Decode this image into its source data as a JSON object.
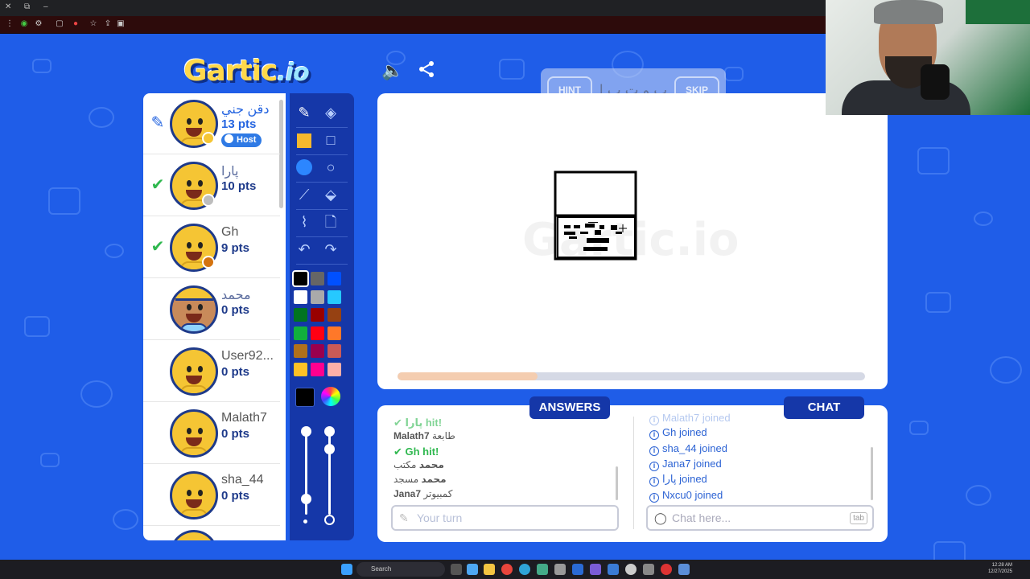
{
  "browser": {
    "toolbar_icons": [
      "shield-icon",
      "extension-icon",
      "tabs-icon",
      "record-icon",
      "star-icon",
      "share-icon",
      "profile-icon"
    ]
  },
  "header": {
    "logo_text": "Gartic",
    "logo_suffix": ".io",
    "sound_icon": "speaker-icon",
    "share_icon": "share-icon"
  },
  "word_hint": {
    "hint_label": "HINT",
    "word": "ب و ت ب ا ل",
    "skip_label": "SKIP"
  },
  "players": [
    {
      "name": "دقن جني",
      "points": "13 pts",
      "status": "drawing",
      "dot_color": "#f5c534",
      "host_label": "Host",
      "avatar": "default"
    },
    {
      "name": "پارا",
      "points": "10 pts",
      "status": "guessed",
      "dot_color": "#bdbdbd",
      "avatar": "default"
    },
    {
      "name": "Gh",
      "points": "9 pts",
      "status": "guessed",
      "dot_color": "#d4730f",
      "avatar": "default"
    },
    {
      "name": "محمد",
      "points": "0 pts",
      "status": "none",
      "avatar": "cap"
    },
    {
      "name": "User92...",
      "points": "0 pts",
      "status": "none",
      "avatar": "default"
    },
    {
      "name": "Malath7",
      "points": "0 pts",
      "status": "none",
      "avatar": "default"
    },
    {
      "name": "sha_44",
      "points": "0 pts",
      "status": "none",
      "avatar": "default"
    }
  ],
  "tools": {
    "items": [
      "pencil-icon",
      "eraser-icon",
      "filled-rect-icon",
      "rect-icon",
      "filled-circle-icon",
      "circle-icon",
      "line-icon",
      "fill-bucket-icon",
      "eyedropper-icon",
      "blank-page-icon",
      "undo-icon",
      "redo-icon"
    ],
    "palette": [
      "#000000",
      "#666666",
      "#0050ff",
      "#ffffff",
      "#aaaaaa",
      "#26c9ff",
      "#017420",
      "#990000",
      "#964112",
      "#11b03c",
      "#ff0013",
      "#ff7829",
      "#b0701c",
      "#99004e",
      "#cb5a57",
      "#ffc126",
      "#ff008f",
      "#feafa8"
    ],
    "selected_color": "#000000"
  },
  "canvas": {
    "watermark": "Gartic.io",
    "progress": 0.3
  },
  "answers": {
    "title": "ANSWERS",
    "messages": [
      {
        "type": "hit",
        "text": "پارا hit!"
      },
      {
        "type": "guess",
        "user": "Malath7",
        "text": "طابعة"
      },
      {
        "type": "hit",
        "text": "Gh hit!"
      },
      {
        "type": "guess",
        "user": "محمد",
        "text": "مكتب"
      },
      {
        "type": "guess",
        "user": "محمد",
        "text": "مسجد"
      },
      {
        "type": "guess",
        "user": "Jana7",
        "text": "كمبيوتر"
      }
    ],
    "input_placeholder": "Your turn"
  },
  "chat": {
    "title": "CHAT",
    "messages": [
      {
        "user": "Malath7",
        "text": "joined"
      },
      {
        "user": "Gh",
        "text": "joined"
      },
      {
        "user": "sha_44",
        "text": "joined"
      },
      {
        "user": "Jana7",
        "text": "joined"
      },
      {
        "user": "پارا",
        "text": "joined"
      },
      {
        "user": "Nxcu0",
        "text": "joined"
      }
    ],
    "input_placeholder": "Chat here...",
    "tab_key": "tab"
  },
  "taskbar": {
    "search_label": "Search",
    "time": "12:28 AM",
    "date": "12/27/2025"
  }
}
